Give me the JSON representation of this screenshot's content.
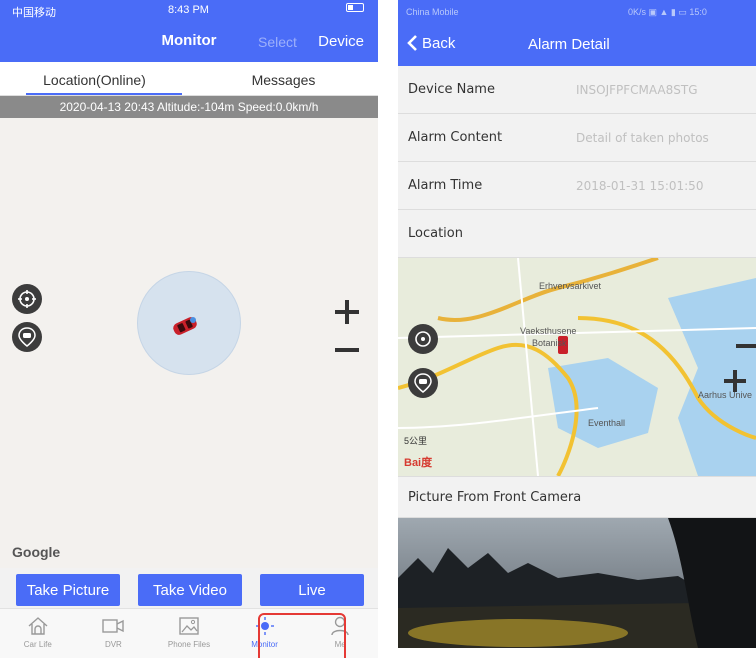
{
  "left": {
    "status": {
      "carrier": "中国移动",
      "time": "8:43 PM"
    },
    "nav": {
      "title": "Monitor",
      "select": "Select",
      "device": "Device"
    },
    "tabs": [
      "Location(Online)",
      "Messages"
    ],
    "info_bar": "2020-04-13 20:43  Altitude:-104m  Speed:0.0km/h",
    "map_logo": "Google",
    "actions": [
      "Take Picture",
      "Take Video",
      "Live"
    ],
    "tabbar": [
      {
        "label": "Car Life",
        "icon": "home-icon"
      },
      {
        "label": "DVR",
        "icon": "video-camera-icon"
      },
      {
        "label": "Phone Files",
        "icon": "image-icon"
      },
      {
        "label": "Monitor",
        "icon": "monitor-pin-icon"
      },
      {
        "label": "Me",
        "icon": "person-icon"
      }
    ]
  },
  "right": {
    "status": {
      "carrier": "China Mobile",
      "network": "0K/s",
      "time": "15:0"
    },
    "nav": {
      "back": "Back",
      "title": "Alarm Detail"
    },
    "rows": [
      {
        "key": "Device Name",
        "value": "INSOJFPFCMAA8STG"
      },
      {
        "key": "Alarm Content",
        "value": "Detail of taken photos"
      },
      {
        "key": "Alarm Time",
        "value": "2018-01-31 15:01:50"
      },
      {
        "key": "Location",
        "value": ""
      }
    ],
    "map_labels": {
      "place1": "Erhvervsarkivet",
      "place2": "Vaeksthusene",
      "place3": "Botanisk",
      "place4": "Aarhus Unive",
      "place5": "Eventhall",
      "scale": "5公里",
      "logo": "Bai度"
    },
    "picture_header": "Picture From Front Camera"
  },
  "colors": {
    "accent": "#4a6cf7",
    "highlight": "#e53935"
  }
}
